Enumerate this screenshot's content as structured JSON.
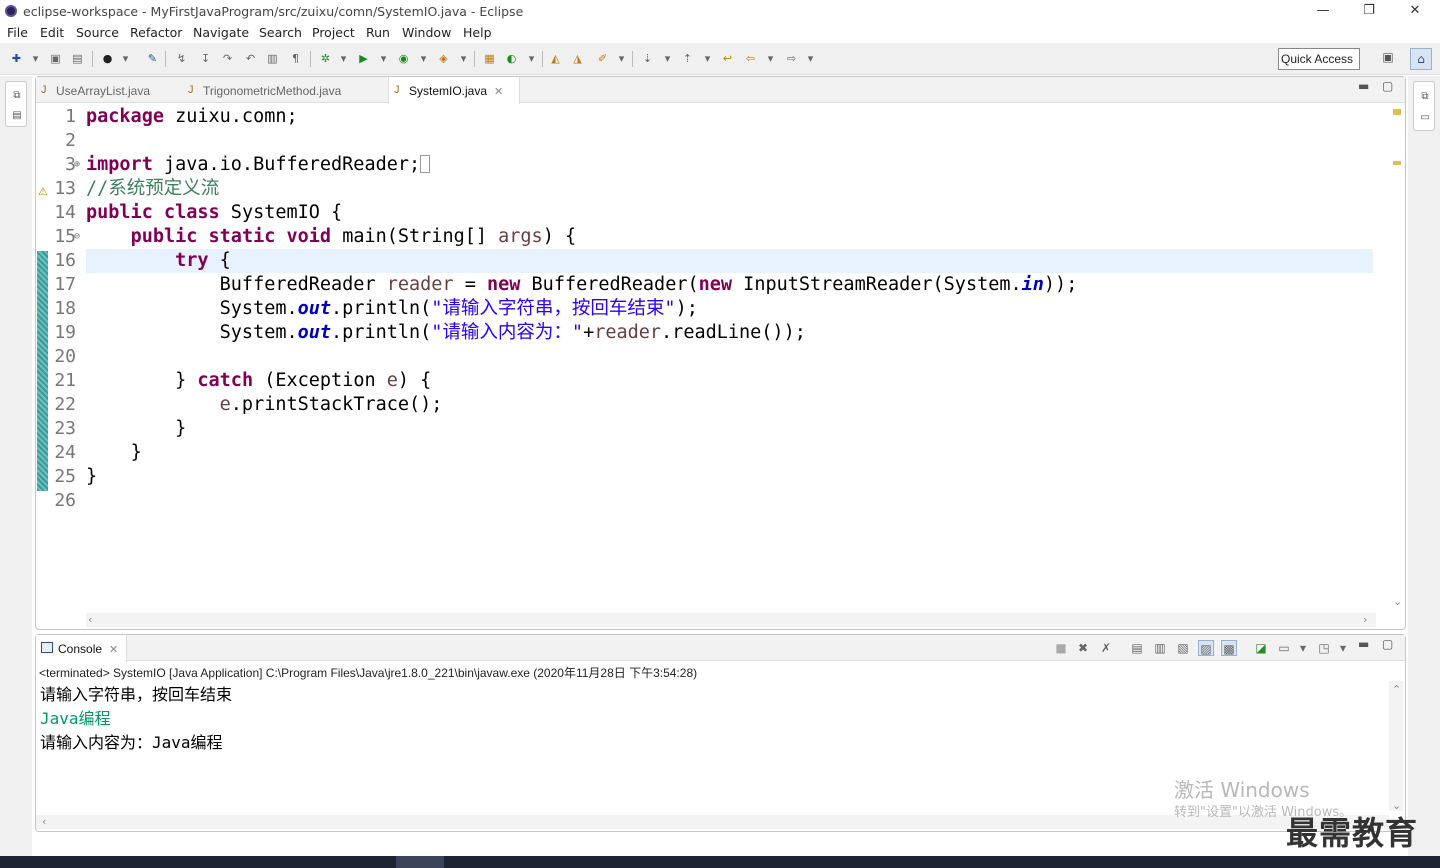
{
  "window": {
    "title": "eclipse-workspace - MyFirstJavaProgram/src/zuixu/comn/SystemIO.java - Eclipse",
    "minimize_glyph": "—",
    "restore_glyph": "❐",
    "close_glyph": "✕"
  },
  "menu": [
    "File",
    "Edit",
    "Source",
    "Refactor",
    "Navigate",
    "Search",
    "Project",
    "Run",
    "Window",
    "Help"
  ],
  "toolbar": {
    "quick_access": "Quick Access"
  },
  "editor": {
    "tabs": [
      {
        "label": "UseArrayList.java",
        "active": false
      },
      {
        "label": "TrigonometricMethod.java",
        "active": false
      },
      {
        "label": "SystemIO.java",
        "active": true,
        "close": "✕"
      }
    ],
    "line_numbers": [
      "1",
      "2",
      "3",
      "13",
      "14",
      "15",
      "16",
      "17",
      "18",
      "19",
      "20",
      "21",
      "22",
      "23",
      "24",
      "25",
      "26"
    ],
    "code": {
      "l1_kw": "package",
      "l1_rest": " zuixu.comn;",
      "l3_kw": "import",
      "l3_rest": " java.io.BufferedReader;",
      "l13_comment": "//系统预定义流",
      "l14_kw1": "public",
      "l14_kw2": "class",
      "l14_rest": " SystemIO {",
      "l15_kw1": "public",
      "l15_kw2": "static",
      "l15_kw3": "void",
      "l15_rest1": " main(String[] ",
      "l15_var": "args",
      "l15_rest2": ") {",
      "l16_kw": "try",
      "l16_rest": " {",
      "l17_a": "BufferedReader ",
      "l17_var": "reader",
      "l17_b": " = ",
      "l17_kw1": "new",
      "l17_c": " BufferedReader(",
      "l17_kw2": "new",
      "l17_d": " InputStreamReader(System.",
      "l17_fld": "in",
      "l17_e": "));",
      "l18_a": "System.",
      "l18_fld": "out",
      "l18_b": ".println(",
      "l18_str": "\"请输入字符串，按回车结束\"",
      "l18_c": ");",
      "l19_a": "System.",
      "l19_fld": "out",
      "l19_b": ".println(",
      "l19_str": "\"请输入内容为：\"",
      "l19_c": "+",
      "l19_var": "reader",
      "l19_d": ".readLine());",
      "l21_a": "} ",
      "l21_kw": "catch",
      "l21_b": " (Exception ",
      "l21_var": "e",
      "l21_c": ") {",
      "l22_var": "e",
      "l22_rest": ".printStackTrace();",
      "close_brace": "}"
    }
  },
  "console": {
    "tab_label": "Console",
    "tab_close": "✕",
    "status": "<terminated> SystemIO [Java Application] C:\\Program Files\\Java\\jre1.8.0_221\\bin\\javaw.exe (2020年11月28日 下午3:54:28)",
    "output": [
      {
        "text": "请输入字符串，按回车结束",
        "kind": "stdout"
      },
      {
        "text": "Java编程",
        "kind": "stdin"
      },
      {
        "text": "请输入内容为：Java编程",
        "kind": "stdout"
      }
    ]
  },
  "overlay": {
    "activate_title": "激活 Windows",
    "activate_sub": "转到\"设置\"以激活 Windows。",
    "brand": "最需教育"
  },
  "colors": {
    "keyword": "#7f0055",
    "comment": "#3f7f5f",
    "string": "#2a00ff",
    "field": "#0000c0",
    "local_var": "#6a3e3e",
    "stdin": "#009966",
    "current_line": "#e8f2fe"
  }
}
